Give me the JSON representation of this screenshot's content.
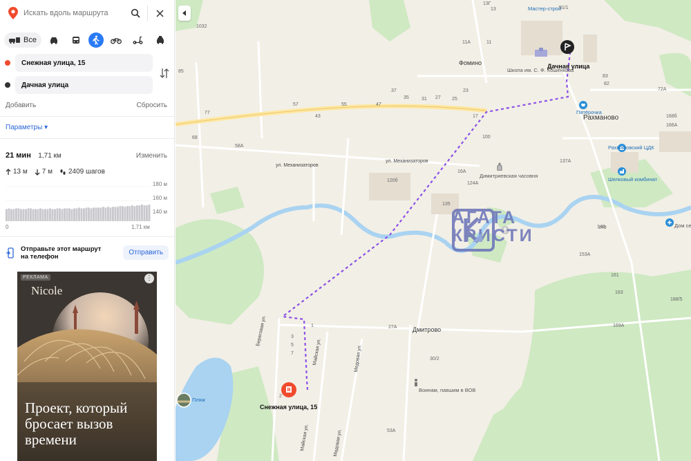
{
  "search": {
    "placeholder": "Искать вдоль маршрута"
  },
  "modes": {
    "all_label": "Все"
  },
  "route_points": {
    "from": "Снежная улица, 15",
    "to": "Дачная улица"
  },
  "actions": {
    "add": "Добавить",
    "reset": "Сбросить",
    "params": "Параметры ▾"
  },
  "route": {
    "time": "21 мин",
    "distance": "1,71 км",
    "edit": "Изменить",
    "ascent": "13 м",
    "descent": "7 м",
    "steps": "2409 шагов"
  },
  "elevation": {
    "y_ticks": [
      "180 м",
      "160 м",
      "140 м"
    ],
    "x_start": "0",
    "x_end": "1,71 км",
    "profile": [
      146,
      147,
      146,
      146,
      147,
      147,
      146,
      146,
      146,
      147,
      147,
      146,
      146,
      146,
      147,
      146,
      146,
      146,
      147,
      146,
      146,
      147,
      147,
      146,
      147,
      147,
      147,
      146,
      147,
      147,
      148,
      147,
      147,
      148,
      148,
      147,
      148,
      148,
      148,
      148,
      149,
      148,
      149,
      148,
      149,
      149,
      149,
      150,
      150,
      149,
      150,
      150,
      151,
      150,
      151,
      151,
      152,
      151,
      151,
      152
    ]
  },
  "share": {
    "text": "Отправьте этот маршрут на телефон",
    "button": "Отправить"
  },
  "ad": {
    "label": "РЕКЛАМА",
    "brand": "Nicole",
    "headline": "Проект, который бросает вызов времени"
  },
  "map": {
    "places": {
      "fomino": "Фомино",
      "rakhmanovo": "Рахманово",
      "dmitrovo": "Дмитрово"
    },
    "poi": {
      "master_stroy": "Мастер-строй",
      "school": "Школа им. С. Ф. Кошенкова",
      "pyaterochka": "Пятёрочка",
      "cdk": "Рахмановский ЦДК",
      "kombinat": "Шелковый комбинат",
      "chapel": "Димитриевская часовня",
      "warriors": "Воинам, павшим в ВОВ",
      "beach": "Пляж",
      "hospice": "Дом сестринского ухода"
    },
    "streets": {
      "mekh1": "ул. Механизаторов",
      "mekh2": "ул. Механизаторов",
      "beregovaya": "Береговая ул.",
      "mayskaya1": "Майская ул.",
      "mayskaya2": "Майская ул.",
      "medovaya1": "Медовая ул.",
      "medovaya2": "Медовая ул."
    },
    "markers": {
      "start": "Снежная улица, 15",
      "end": "Дачная улица"
    },
    "watermark": {
      "line1": "АГАТА",
      "line2": "КРИСТИ"
    },
    "numbers": [
      "13Г",
      "1032",
      "91/1",
      "85",
      "77",
      "68",
      "58А",
      "57",
      "55",
      "47",
      "43",
      "37",
      "35",
      "31",
      "27",
      "25",
      "23",
      "17",
      "13",
      "11А",
      "11",
      "7",
      "5",
      "3",
      "2",
      "1",
      "120б",
      "135",
      "124А",
      "16А",
      "153А",
      "149",
      "161",
      "163",
      "169А",
      "188/5",
      "27А",
      "30/2",
      "53А",
      "72А",
      "82",
      "83",
      "100",
      "137А",
      "149",
      "166А",
      "168б"
    ],
    "colors": {
      "route": "#8b4fe6",
      "start_marker": "#f04b2e",
      "water": "#a9d3f1",
      "forest": "#cfe9c3",
      "road": "#ffe7a0"
    }
  }
}
